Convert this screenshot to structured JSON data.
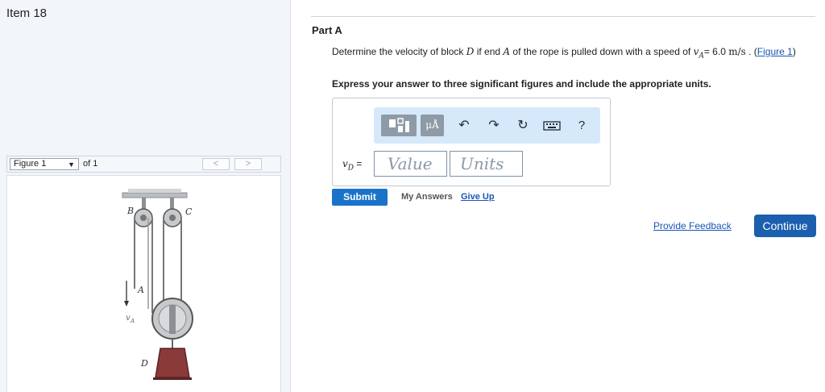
{
  "item": {
    "title": "Item 18"
  },
  "figure": {
    "select_label": "Figure 1",
    "of_text": "of 1",
    "prev_symbol": "<",
    "next_symbol": ">",
    "labels": {
      "B": "B",
      "C": "C",
      "A": "A",
      "vA": "v",
      "vA_sub": "A",
      "D": "D"
    }
  },
  "part": {
    "label": "Part A",
    "question_pre": "Determine the velocity of block ",
    "question_D": "D",
    "question_mid": " if end ",
    "question_A": "A",
    "question_mid2": " of the rope is pulled down with a speed of ",
    "question_v": "v",
    "question_vsub": "A",
    "question_eq": "= 6.0 ",
    "question_unit": "m/s",
    "question_post": " . (",
    "figure_link": "Figure 1",
    "question_close": ")",
    "instruction": "Express your answer to three significant figures and include the appropriate units."
  },
  "toolbar": {
    "mu_label": "μÅ",
    "undo_icon": "↶",
    "redo_icon": "↷",
    "reset_icon": "↻",
    "help_label": "?"
  },
  "answer": {
    "var_v": "v",
    "var_sub": "D",
    "var_eq": " =",
    "value_placeholder": "Value",
    "units_placeholder": "Units"
  },
  "actions": {
    "submit_label": "Submit",
    "my_answers_label": "My Answers",
    "give_up_label": "Give Up",
    "feedback_label": "Provide Feedback",
    "continue_label": "Continue"
  },
  "colors": {
    "primary_blue": "#1b73c9",
    "continue_blue": "#1b5fae",
    "link_blue": "#1b56b5",
    "toolbar_bg": "#d6e9fb",
    "block_color": "#8b3a3a"
  },
  "icons": [
    "grid-template-icon",
    "undo-icon",
    "redo-icon",
    "reset-icon",
    "keyboard-icon",
    "help-icon"
  ]
}
